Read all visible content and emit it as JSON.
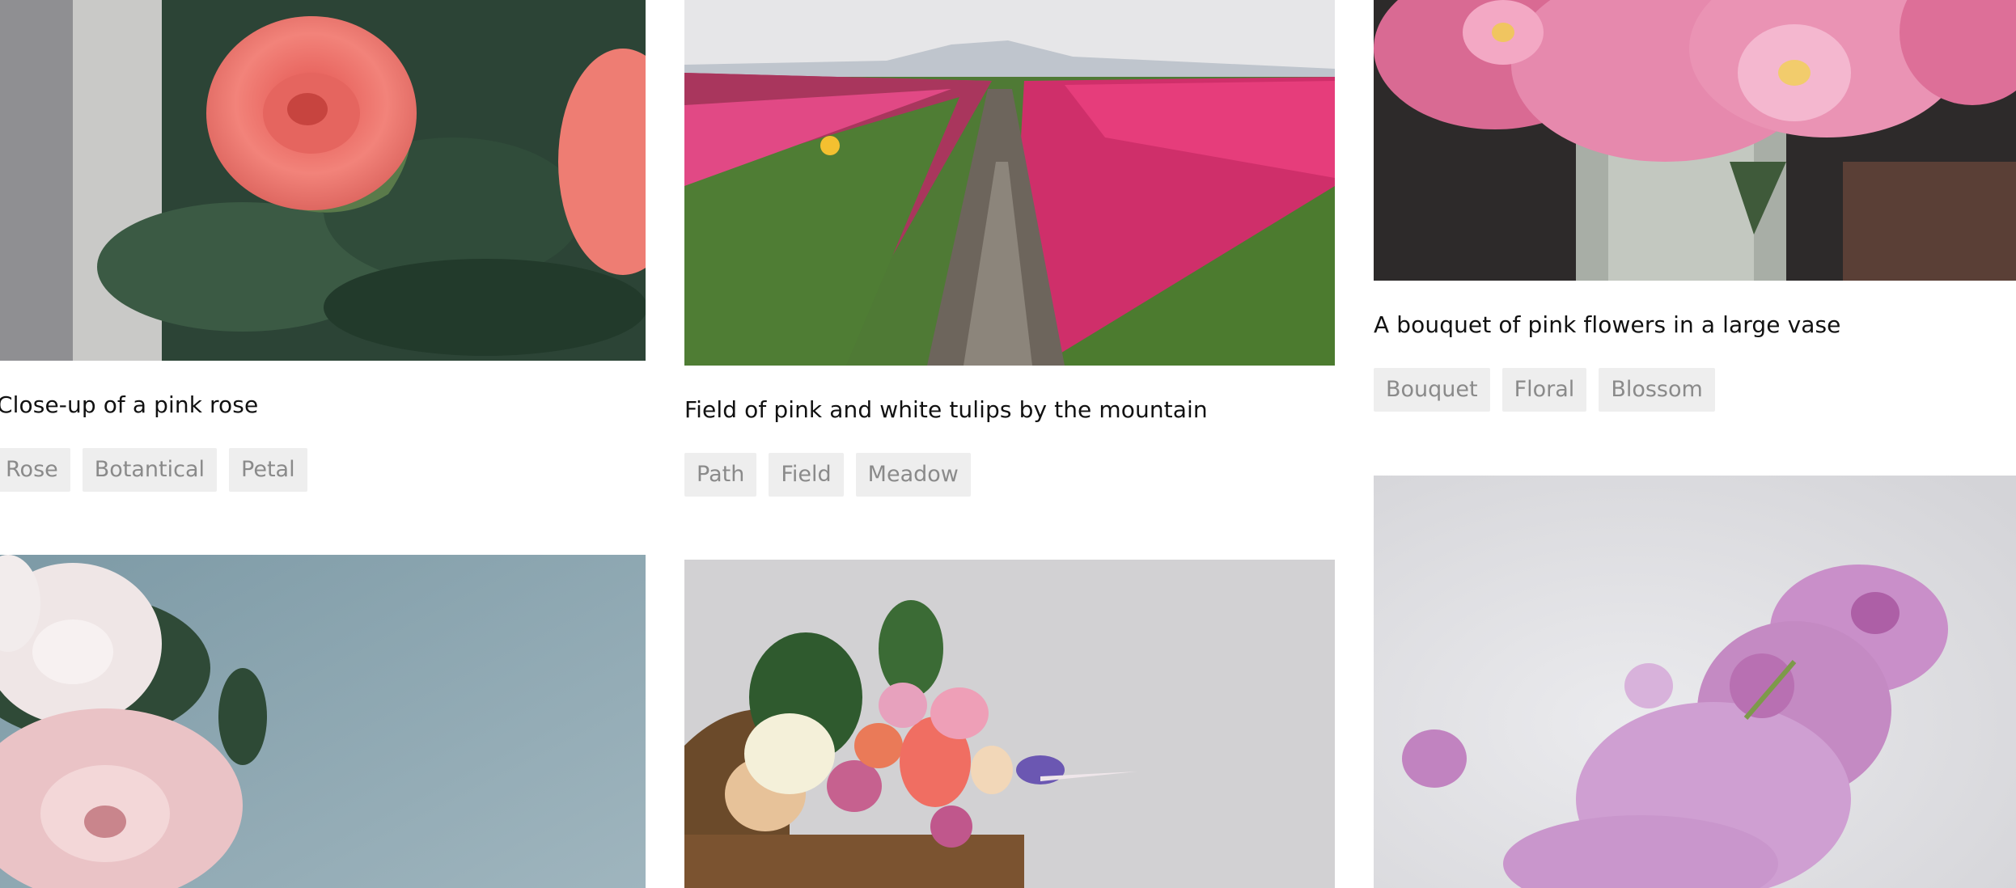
{
  "colors": {
    "tag_bg": "#eeeeee",
    "tag_text": "#8a8a8a",
    "caption": "#111111",
    "page_bg": "#ffffff"
  },
  "cards": [
    {
      "image": "pink-rose-photo",
      "caption": "Close-up of a pink rose",
      "tags": [
        "Rose",
        "Botantical",
        "Petal"
      ]
    },
    {
      "image": "tulip-field-photo",
      "caption": "Field of pink and white tulips by the mountain",
      "tags": [
        "Path",
        "Field",
        "Meadow"
      ]
    },
    {
      "image": "peony-vase-photo",
      "caption": "A bouquet of pink flowers in a large vase",
      "tags": [
        "Bouquet",
        "Floral",
        "Blossom"
      ]
    },
    {
      "image": "white-peony-photo"
    },
    {
      "image": "flower-basket-photo"
    },
    {
      "image": "lilac-photo"
    }
  ]
}
